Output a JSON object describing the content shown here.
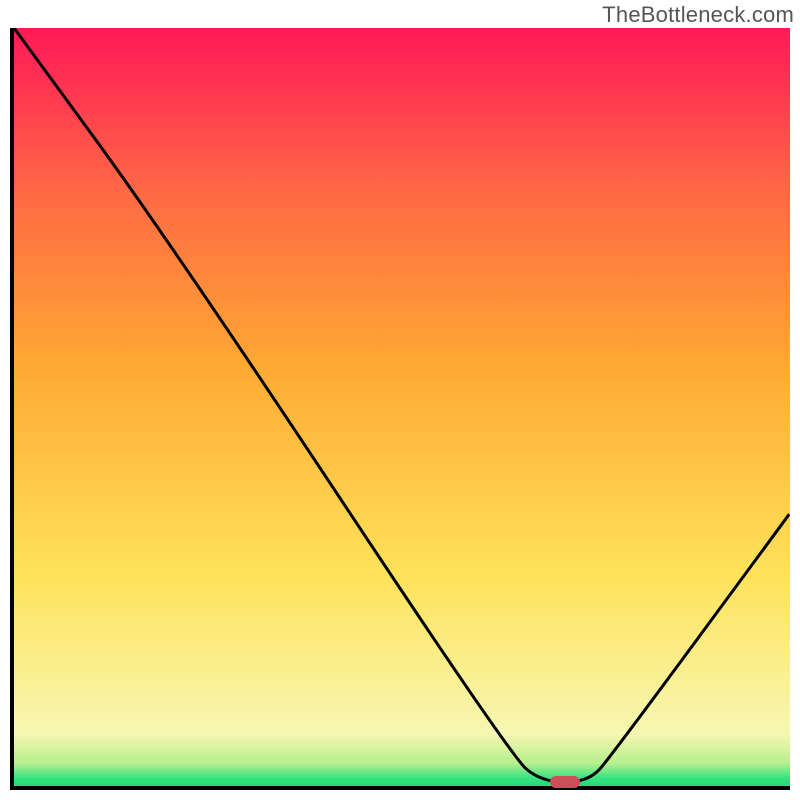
{
  "watermark": "TheBottleneck.com",
  "chart_data": {
    "type": "line",
    "title": "",
    "xlabel": "",
    "ylabel": "",
    "xlim": [
      0,
      100
    ],
    "ylim": [
      0,
      100
    ],
    "grid": false,
    "legend": false,
    "gradient": {
      "top": "#ff1a55",
      "middle": "#ffe25a",
      "bottom": "#22dd77"
    },
    "curve": {
      "x": [
        0,
        20,
        64,
        68,
        74,
        77,
        100
      ],
      "y": [
        100,
        72,
        4,
        0.5,
        0.5,
        4,
        36
      ]
    },
    "marker": {
      "x": 71,
      "y": 0.5,
      "color": "#cc4f5a"
    }
  }
}
